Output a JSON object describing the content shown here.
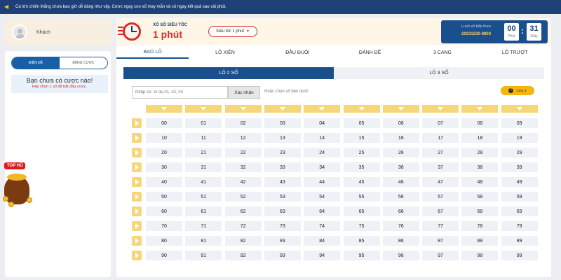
{
  "notice": {
    "icon": "speaker-icon",
    "text": "Cá lớn chiến thắng chưa bao giờ dễ dàng như vậy. Cược ngay con số may mắn và có ngay kết quả sau vài phút."
  },
  "user": {
    "name": "Khách",
    "avatar_icon": "user-avatar-icon"
  },
  "side_panel": {
    "tabs": [
      "ĐIỆN ĐỀ",
      "BẢNG CƯỢC"
    ],
    "active_tab": 0,
    "message": "Bạn chưa có cược nào!",
    "sub_message": "Hãy chọn 1 số để bắt đầu cược."
  },
  "top_hu": {
    "label": "TOP HŨ"
  },
  "header": {
    "logo_sub": "XỔ SỐ SIÊU TỐC",
    "logo_main": "1 phút",
    "select_value": "Siêu tốc 1 phút",
    "timer": {
      "label": "Lượt xổ tiếp theo",
      "round": "20231230-0803",
      "minutes": "00",
      "seconds": "31",
      "min_unit": "Phút",
      "sec_unit": "Giây"
    }
  },
  "bet_tabs": [
    "BAO LÔ",
    "LÔ XIÊN",
    "ĐẦU ĐUÔI",
    "ĐÁNH ĐỀ",
    "3 CANG",
    "LÔ TRƯỢT"
  ],
  "active_bet_tab": 0,
  "sub_tabs": [
    "LÔ 2 SỐ",
    "LÔ 3 SỐ"
  ],
  "active_sub_tab": 0,
  "input": {
    "placeholder": "Nhập số: Ví dụ 01, 02, 03",
    "confirm": "Xác nhận",
    "hint": "Hoặc chọn số bên dưới",
    "guide": "Lưu ý"
  },
  "numbers": [
    [
      "00",
      "01",
      "02",
      "03",
      "04",
      "05",
      "06",
      "07",
      "08",
      "09"
    ],
    [
      "10",
      "11",
      "12",
      "13",
      "14",
      "15",
      "16",
      "17",
      "18",
      "19"
    ],
    [
      "20",
      "21",
      "22",
      "23",
      "24",
      "25",
      "26",
      "27",
      "28",
      "29"
    ],
    [
      "30",
      "31",
      "32",
      "33",
      "34",
      "35",
      "36",
      "37",
      "38",
      "39"
    ],
    [
      "40",
      "41",
      "42",
      "43",
      "44",
      "45",
      "46",
      "47",
      "48",
      "49"
    ],
    [
      "50",
      "51",
      "52",
      "53",
      "54",
      "55",
      "56",
      "57",
      "58",
      "59"
    ],
    [
      "60",
      "61",
      "62",
      "63",
      "64",
      "65",
      "66",
      "67",
      "68",
      "69"
    ],
    [
      "70",
      "71",
      "72",
      "73",
      "74",
      "75",
      "76",
      "77",
      "78",
      "79"
    ],
    [
      "80",
      "81",
      "82",
      "83",
      "84",
      "85",
      "86",
      "87",
      "88",
      "89"
    ],
    [
      "90",
      "91",
      "92",
      "93",
      "94",
      "95",
      "96",
      "97",
      "98",
      "99"
    ]
  ],
  "colors": {
    "primary": "#1a4f8e",
    "accent": "#d82c2c",
    "gold": "#f6d67a",
    "cell": "#eef1f6"
  }
}
